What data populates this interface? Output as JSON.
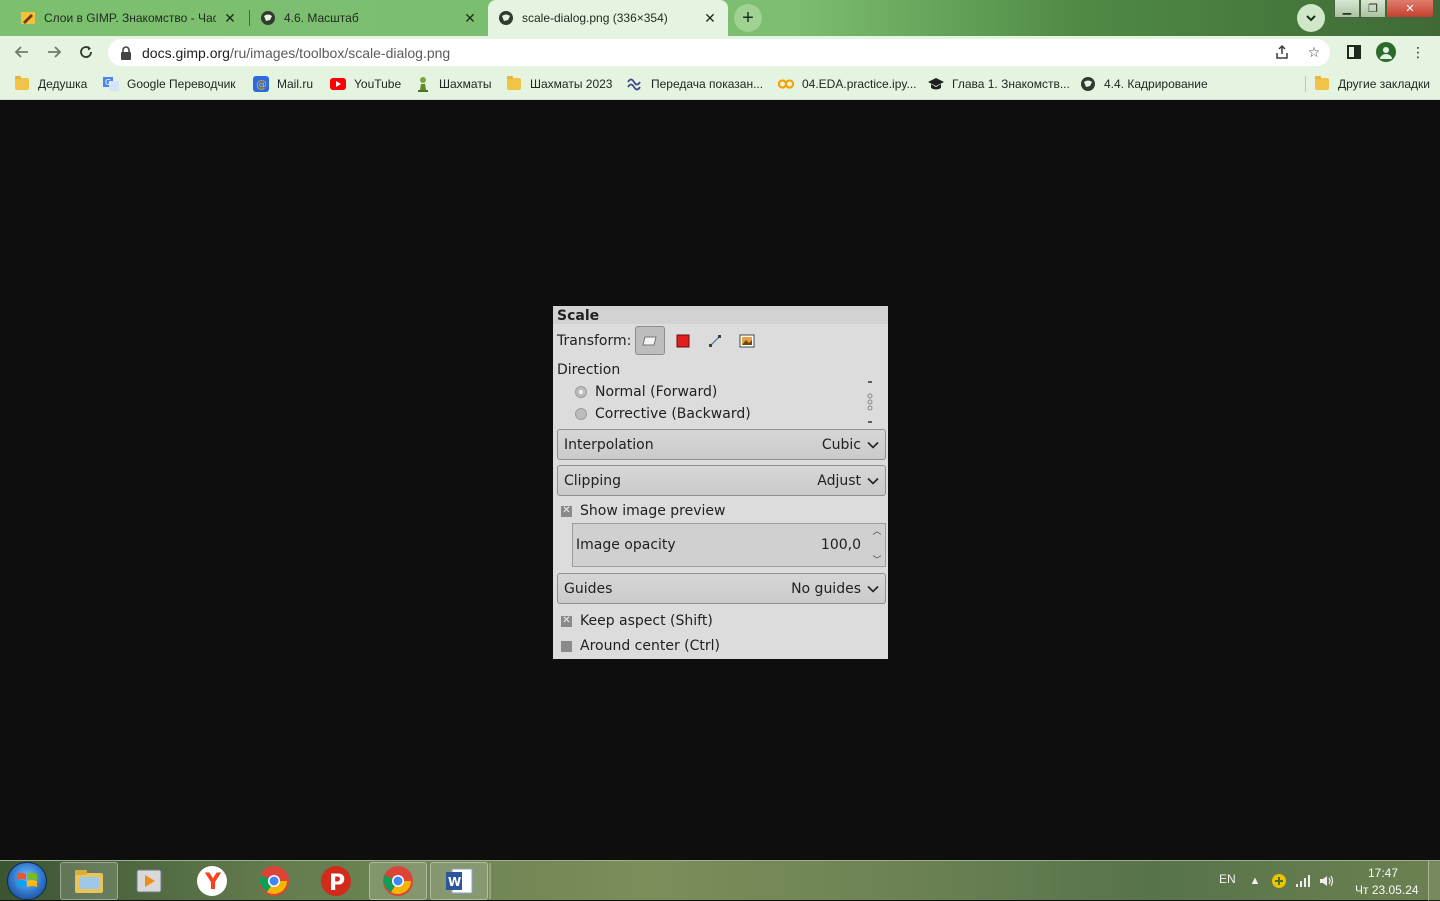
{
  "browser": {
    "tabs": [
      {
        "title": "Слои в GIMP. Знакомство - Част",
        "icon": "pencil-favicon-icon",
        "active": false
      },
      {
        "title": "4.6. Масштаб",
        "icon": "globe-favicon-icon",
        "active": false
      },
      {
        "title": "scale-dialog.png (336×354)",
        "icon": "globe-favicon-icon",
        "active": true
      }
    ],
    "new_tab_label": "+",
    "address": {
      "host": "docs.gimp.org",
      "path": "/ru/images/toolbox/scale-dialog.png"
    },
    "bookmarks": [
      {
        "label": "Дедушка",
        "icon": "folder-icon"
      },
      {
        "label": "Google Переводчик",
        "icon": "google-translate-icon"
      },
      {
        "label": "Mail.ru",
        "icon": "mailru-icon"
      },
      {
        "label": "YouTube",
        "icon": "youtube-icon"
      },
      {
        "label": "Шахматы",
        "icon": "chess-pawn-icon"
      },
      {
        "label": "Шахматы 2023",
        "icon": "folder-icon"
      },
      {
        "label": "Передача показан...",
        "icon": "wave-icon"
      },
      {
        "label": "04.EDA.practice.ipy...",
        "icon": "colab-icon"
      },
      {
        "label": "Глава 1. Знакомств...",
        "icon": "graduation-cap-icon"
      },
      {
        "label": "4.4. Кадрирование",
        "icon": "globe-icon"
      }
    ],
    "other_bookmarks": "Другие закладки",
    "colors": {
      "frame": "#7bbf6f",
      "toolbar": "#e5f3e1"
    }
  },
  "dialog": {
    "title": "Scale",
    "transform_label": "Transform:",
    "direction_label": "Direction",
    "direction_options": [
      {
        "label": "Normal (Forward)",
        "selected": true
      },
      {
        "label": "Corrective (Backward)",
        "selected": false
      }
    ],
    "interpolation": {
      "label": "Interpolation",
      "value": "Cubic"
    },
    "clipping": {
      "label": "Clipping",
      "value": "Adjust"
    },
    "show_preview": {
      "label": "Show image preview",
      "checked": true
    },
    "image_opacity": {
      "label": "Image opacity",
      "value": "100,0"
    },
    "guides": {
      "label": "Guides",
      "value": "No guides"
    },
    "keep_aspect": {
      "label": "Keep aspect (Shift)",
      "checked": true
    },
    "around_center": {
      "label": "Around center (Ctrl)",
      "checked": false
    }
  },
  "taskbar": {
    "language": "EN",
    "time": "17:47",
    "date": "Чт 23.05.24"
  }
}
